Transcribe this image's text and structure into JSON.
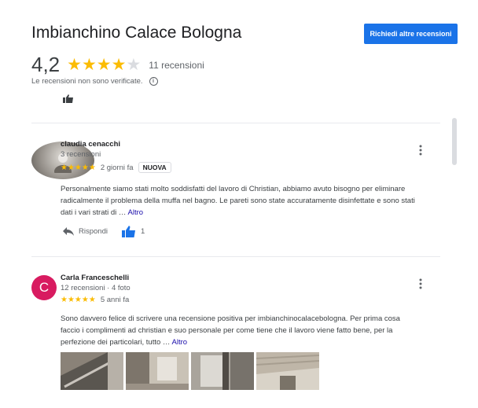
{
  "header": {
    "title": "Imbianchino Calace Bologna",
    "request_button": "Richiedi altre recensioni",
    "rating": "4,2",
    "rating_value": 4.2,
    "review_count": "11 recensioni",
    "unverified_note": "Le recensioni non sono verificate."
  },
  "colors": {
    "star": "#fbbc04",
    "primary_button": "#1a73e8",
    "like_active": "#1a73e8",
    "avatar_c": "#d81b60"
  },
  "reviews": [
    {
      "author": "claudia cenacchi",
      "meta": "3 recensioni",
      "stars": "★★★★★",
      "rating": 5,
      "date": "2 giorni fa",
      "badge": "NUOVA",
      "text": "Personalmente siamo stati molto soddisfatti del lavoro di Christian, abbiamo avuto bisogno per eliminare radicalmente il problema della muffa nel bagno. Le pareti sono state accuratamente disinfettate e sono stati dati i vari strati di …",
      "more": "Altro",
      "reply_label": "Rispondi",
      "like_count": "1"
    },
    {
      "author": "Carla Franceschelli",
      "avatar_letter": "C",
      "meta": "12 recensioni · 4 foto",
      "stars": "★★★★★",
      "rating": 5,
      "date": "5 anni fa",
      "text": "Sono davvero felice di scrivere una recensione positiva per imbianchinocalacebologna. Per prima cosa faccio i complimenti ad christian e suo personale per come tiene che il lavoro viene fatto bene, per la perfezione dei particolari, tutto …",
      "more": "Altro"
    }
  ],
  "icons": [
    "info-icon",
    "thumb-up-icon",
    "reply-icon",
    "more-vert-icon"
  ]
}
